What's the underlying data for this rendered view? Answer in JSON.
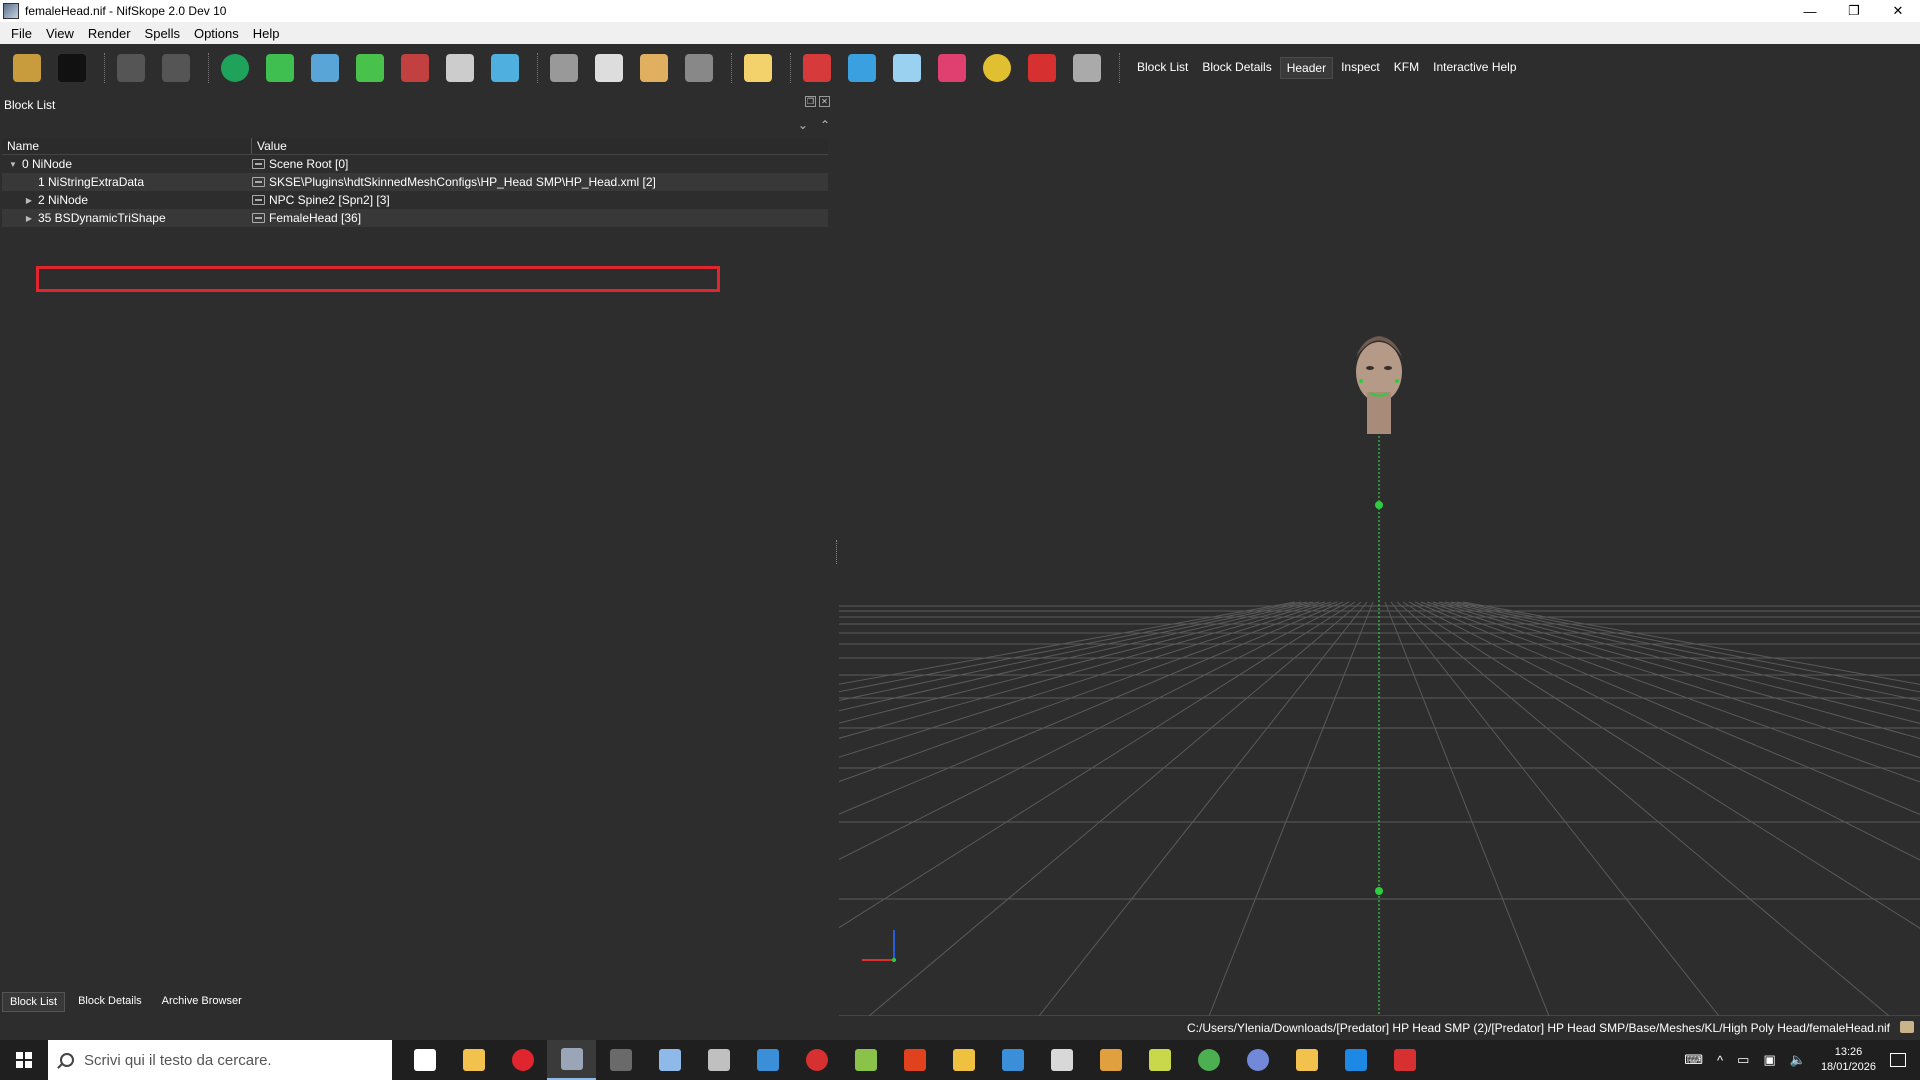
{
  "window": {
    "title": "femaleHead.nif - NifSkope 2.0 Dev 10",
    "controls": [
      "—",
      "❐",
      "✕"
    ]
  },
  "menu": [
    "File",
    "View",
    "Render",
    "Spells",
    "Options",
    "Help"
  ],
  "toolbar": {
    "buttons": [
      {
        "name": "open-icon",
        "color": "#c89b3c"
      },
      {
        "name": "save-icon",
        "color": "#111111"
      },
      {
        "name": "undo-icon",
        "color": "#555555"
      },
      {
        "name": "redo-icon",
        "color": "#555555"
      },
      {
        "name": "select-object-icon",
        "color": "#1fa35a"
      },
      {
        "name": "select-vertex-icon",
        "color": "#3fbf4f"
      },
      {
        "name": "view-front-icon",
        "color": "#5aa5d8"
      },
      {
        "name": "view-top-icon",
        "color": "#48c24a"
      },
      {
        "name": "view-side-icon",
        "color": "#c24040"
      },
      {
        "name": "view-flip-icon",
        "color": "#cccccc"
      },
      {
        "name": "view-perspective-icon",
        "color": "#4fb0e0"
      },
      {
        "name": "walk-icon",
        "color": "#999999"
      },
      {
        "name": "show-hidden-icon",
        "color": "#dddddd"
      },
      {
        "name": "show-nodes-icon",
        "color": "#e0b060"
      },
      {
        "name": "screenshot-icon",
        "color": "#888888"
      },
      {
        "name": "light-icon",
        "color": "#f3d16b"
      },
      {
        "name": "draw-axes-icon",
        "color": "#d63a3a"
      },
      {
        "name": "draw-nodes-icon",
        "color": "#3aa0e0"
      },
      {
        "name": "draw-havok-icon",
        "color": "#9ad1f0"
      },
      {
        "name": "draw-constraints-icon",
        "color": "#e04070"
      },
      {
        "name": "draw-furniture-icon",
        "color": "#e0c030"
      },
      {
        "name": "draw-markers-icon",
        "color": "#d63030"
      },
      {
        "name": "hide-selected-icon",
        "color": "#aaaaaa"
      }
    ],
    "dock_tabs": [
      "Block List",
      "Block Details",
      "Header",
      "Inspect",
      "KFM",
      "Interactive Help"
    ],
    "active_dock_tab": "Header"
  },
  "block_list": {
    "title": "Block List",
    "columns": [
      "Name",
      "Value"
    ],
    "rows": [
      {
        "name": "0 NiNode",
        "value": "Scene Root [0]",
        "indent": 0,
        "arrow": "▼"
      },
      {
        "name": "1 NiStringExtraData",
        "value": "SKSE\\Plugins\\hdtSkinnedMeshConfigs\\HP_Head SMP\\HP_Head.xml [2]",
        "indent": 1,
        "arrow": ""
      },
      {
        "name": "2 NiNode",
        "value": "NPC Spine2 [Spn2] [3]",
        "indent": 1,
        "arrow": "▶"
      },
      {
        "name": "35 BSDynamicTriShape",
        "value": "FemaleHead [36]",
        "indent": 1,
        "arrow": "▶"
      }
    ],
    "bottom_tabs": [
      "Block List",
      "Block Details",
      "Archive Browser"
    ],
    "active_bottom_tab": "Block List"
  },
  "status": {
    "path": "C:/Users/Ylenia/Downloads/[Predator] HP Head SMP (2)/[Predator] HP Head SMP/Base/Meshes/KL/High Poly Head/femaleHead.nif"
  },
  "taskbar": {
    "search_placeholder": "Scrivi qui il testo da cercare.",
    "apps": [
      {
        "name": "task-view-icon",
        "color": "#ffffff"
      },
      {
        "name": "file-explorer-icon",
        "color": "#f2c14e"
      },
      {
        "name": "opera-icon",
        "color": "#e0252e"
      },
      {
        "name": "nifskope-icon",
        "color": "#9aa6b8"
      },
      {
        "name": "nexus-mod-manager-icon",
        "color": "#6a6a6a"
      },
      {
        "name": "feather-icon",
        "color": "#8fb9e8"
      },
      {
        "name": "blender-icon",
        "color": "#c0c0c0"
      },
      {
        "name": "store-icon",
        "color": "#3a8fd8"
      },
      {
        "name": "media-icon",
        "color": "#d63030"
      },
      {
        "name": "notepad-icon",
        "color": "#8ac24a"
      },
      {
        "name": "foxit-icon",
        "color": "#e0421e"
      },
      {
        "name": "arrow-app-icon",
        "color": "#f0c040"
      },
      {
        "name": "calendar-app-icon",
        "color": "#3a8fd8"
      },
      {
        "name": "calculator-app-icon",
        "color": "#d8d8d8"
      },
      {
        "name": "horse-app-icon",
        "color": "#e0a040"
      },
      {
        "name": "map-app-icon",
        "color": "#c8d84a"
      },
      {
        "name": "chrome-icon",
        "color": "#4caf50"
      },
      {
        "name": "discord-icon",
        "color": "#7289da"
      },
      {
        "name": "notes-app-icon",
        "color": "#f2c14e"
      },
      {
        "name": "blue-app-icon",
        "color": "#1e88e5"
      },
      {
        "name": "red-app-icon",
        "color": "#d63030"
      }
    ],
    "time": "13:26",
    "date": "18/01/2026"
  }
}
